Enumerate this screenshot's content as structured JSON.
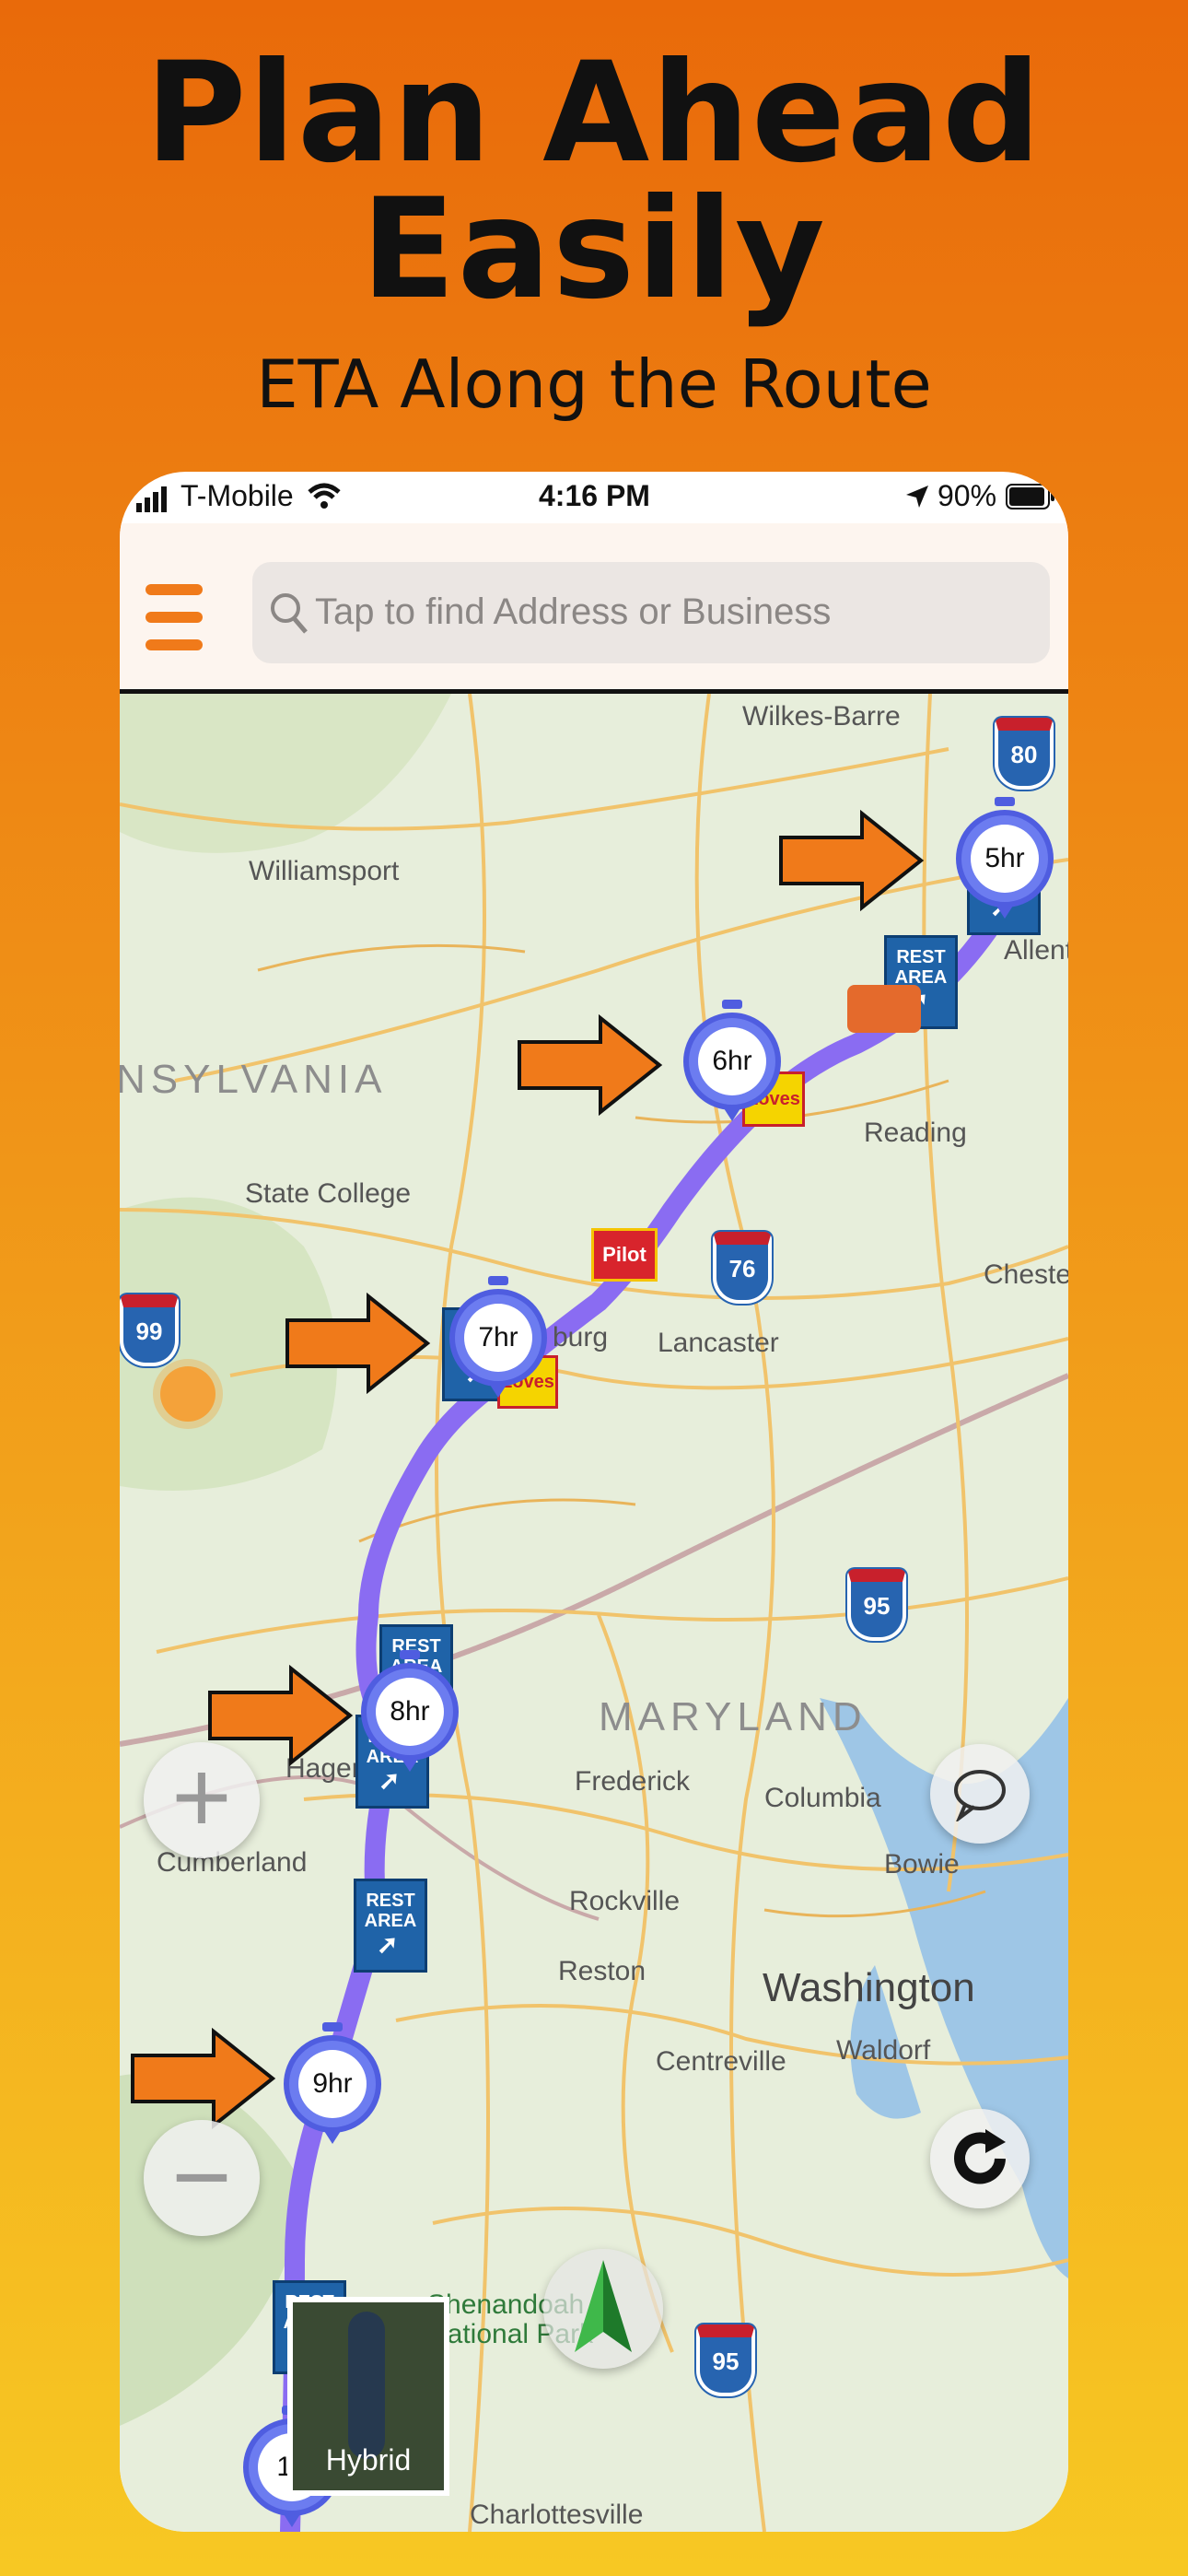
{
  "promo": {
    "headline_line1": "Plan Ahead",
    "headline_line2": "Easily",
    "subheadline": "ETA Along the Route"
  },
  "status_bar": {
    "carrier": "T-Mobile",
    "time": "4:16 PM",
    "battery": "90%"
  },
  "header": {
    "search_placeholder": "Tap to find Address or Business"
  },
  "map": {
    "cities": [
      "Wilkes-Barre",
      "Williamsport",
      "Reading",
      "State College",
      "Lancaster",
      "Frederick",
      "Columbia",
      "Cumberland",
      "Rockville",
      "Bowie",
      "Reston",
      "Washington",
      "Centreville",
      "Waldorf",
      "Charlottesville",
      "Shenandoah",
      "National Park",
      "Allentow",
      "Cheste",
      "Hagers",
      "burg"
    ],
    "states": [
      "NSYLVANIA",
      "MARYLAND"
    ],
    "eta_markers": [
      "5hr",
      "6hr",
      "7hr",
      "8hr",
      "9hr",
      "10"
    ],
    "shields": [
      "80",
      "76",
      "99",
      "95",
      "95"
    ],
    "rest_area_label_top": "REST",
    "rest_area_label_bottom": "AREA",
    "brand_labels": [
      "Pilot",
      "Loves"
    ],
    "route_color": "#8a6cf2",
    "accent_color": "#F07A1A"
  },
  "controls": {
    "zoom_in": "+",
    "zoom_out": "−",
    "hybrid_label": "Hybrid"
  }
}
